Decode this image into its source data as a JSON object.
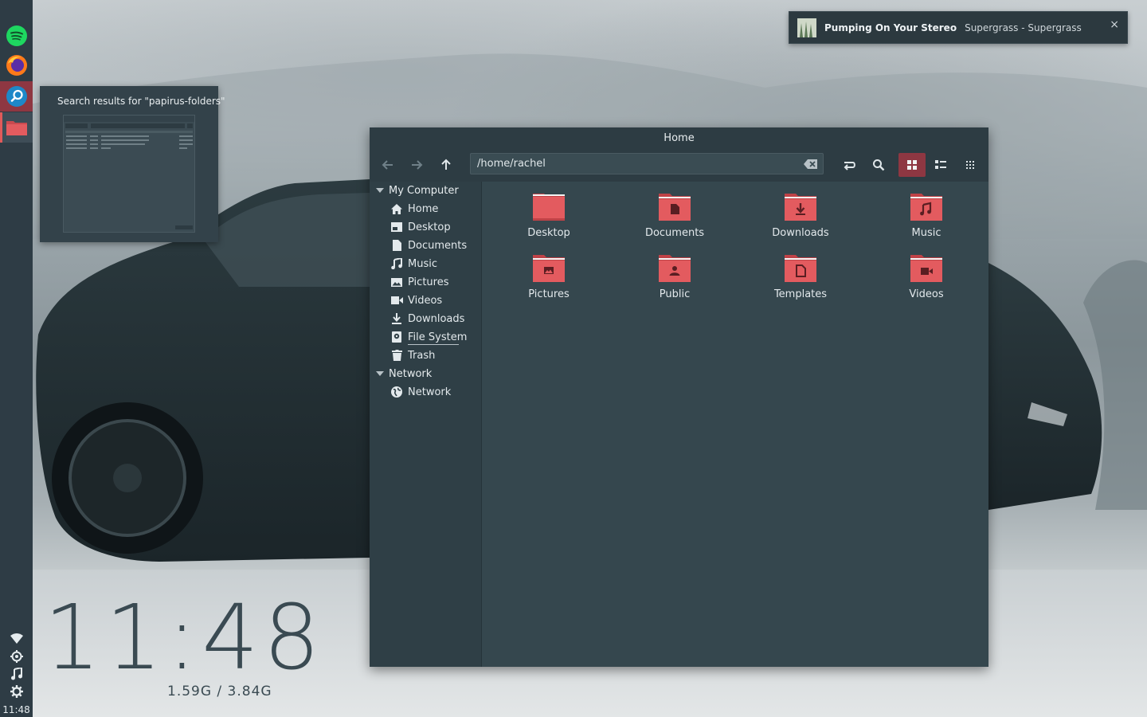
{
  "theme": {
    "accent": "#e05a5a",
    "accent_dark": "#8e3742",
    "panel": "#2e3c45",
    "window": "#35474e"
  },
  "dock": {
    "apps": [
      {
        "name": "spotify-icon",
        "state": "normal"
      },
      {
        "name": "firefox-icon",
        "state": "normal"
      },
      {
        "name": "search-app-icon",
        "state": "running"
      },
      {
        "name": "file-manager-icon",
        "state": "active"
      }
    ],
    "system": [
      "wifi-icon",
      "brightness-icon",
      "music-note-icon",
      "settings-icon"
    ],
    "clock": "11:48"
  },
  "desktop": {
    "clock": "11:48",
    "memory": "1.59G / 3.84G"
  },
  "notification": {
    "title": "Pumping On Your Stereo",
    "body": "Supergrass - Supergrass",
    "close_glyph": "×"
  },
  "preview": {
    "title": "Search results for \"papirus-folders\""
  },
  "file_manager": {
    "title": "Home",
    "path": "/home/rachel",
    "toolbar": [
      "back-icon",
      "forward-icon",
      "up-icon",
      "toggle-location-icon",
      "search-icon",
      "icon-view-icon",
      "list-view-icon",
      "compact-view-icon"
    ],
    "sidebar": {
      "sections": [
        {
          "label": "My Computer",
          "items": [
            {
              "label": "Home",
              "icon": "home-icon"
            },
            {
              "label": "Desktop",
              "icon": "desktop-icon"
            },
            {
              "label": "Documents",
              "icon": "document-icon"
            },
            {
              "label": "Music",
              "icon": "music-icon"
            },
            {
              "label": "Pictures",
              "icon": "picture-icon"
            },
            {
              "label": "Videos",
              "icon": "video-icon"
            },
            {
              "label": "Downloads",
              "icon": "download-icon"
            },
            {
              "label": "File System",
              "icon": "drive-icon"
            },
            {
              "label": "Trash",
              "icon": "trash-icon"
            }
          ]
        },
        {
          "label": "Network",
          "items": [
            {
              "label": "Network",
              "icon": "network-icon"
            }
          ]
        }
      ]
    },
    "folders": [
      {
        "label": "Desktop",
        "icon": "desktop"
      },
      {
        "label": "Documents",
        "icon": "document"
      },
      {
        "label": "Downloads",
        "icon": "download"
      },
      {
        "label": "Music",
        "icon": "music"
      },
      {
        "label": "Pictures",
        "icon": "picture"
      },
      {
        "label": "Public",
        "icon": "public"
      },
      {
        "label": "Templates",
        "icon": "template"
      },
      {
        "label": "Videos",
        "icon": "video"
      }
    ]
  }
}
